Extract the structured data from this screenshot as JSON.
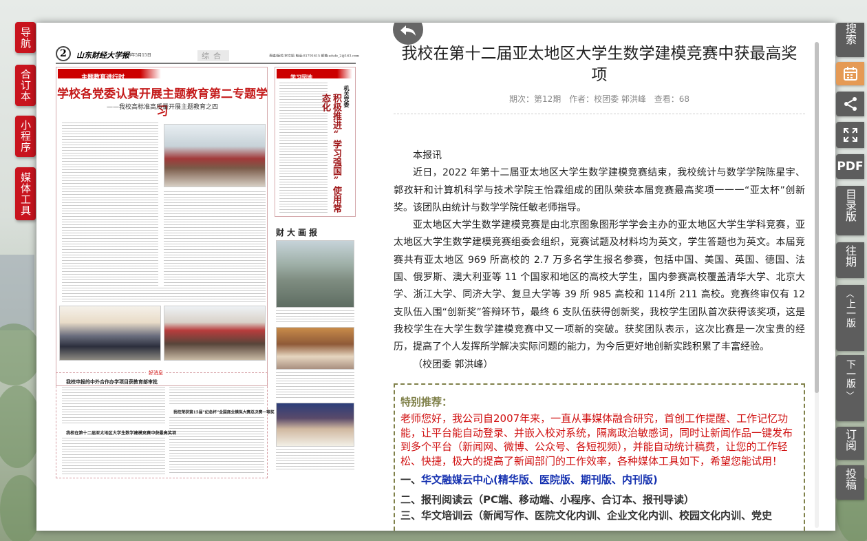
{
  "left_nav": [
    "导航",
    "合订本",
    "小程序",
    "媒体工具"
  ],
  "right_toolbar": {
    "search": "搜索",
    "calendar_icon": "calendar-icon",
    "share_icon": "share-icon",
    "fullscreen_icon": "fullscreen-icon",
    "pdf": "PDF",
    "catalog": "目录版",
    "past": "往期",
    "prev_page": "上一版",
    "next_page": "下一版",
    "subscribe": "订阅",
    "submit": "投稿"
  },
  "newspaper": {
    "page_number": "2",
    "paper_name": "山东财经大学报",
    "date": "2023年5月15日",
    "section": "综合",
    "header_info": "责编/版式:宋文娟  电话:81791615  邮箱:sdufe_2@163.com",
    "tag1": "主题教育进行时",
    "headline": "学校各党委认真开展主题教育第二专题学习",
    "subhead": "——我校高标准高质量开展主题教育之四",
    "tag2": "学习园地",
    "right_title": "机关党委",
    "right_vertical_headline": "积极推进“学习强国”使用常态化",
    "gallery_title": "财大画报",
    "tag3": "好消息",
    "brief1": "我校申报的中外合作办学项目获教育部审批",
    "brief2": "我校荣获第15届“纪念杯”全国商业模拟大赛总决赛一等奖",
    "brief3": "我校在第十二届亚太地区大学生数学建模竞赛中获最高奖项"
  },
  "article": {
    "title": "我校在第十二届亚太地区大学生数学建模竞赛中获最高奖项",
    "meta": {
      "issue": "期次：第12期",
      "author": "作者：校团委 郭洪峰",
      "views": "查看：68"
    },
    "paragraphs": [
      "本报讯",
      "近日，2022 年第十二届亚太地区大学生数学建模竞赛结束，我校统计与数学学院陈星宇、郭孜轩和计算机科学与技术学院王怡霖组成的团队荣获本届竞赛最高奖项一一一“亚太杯”创新奖。该团队由统计与数学学院任敏老师指导。",
      "亚太地区大学生数学建模竞赛是由北京图象图形学学会主办的亚太地区大学生学科竞赛，亚太地区大学生数学建模竞赛组委会组织，竞赛试题及材料均为英文，学生答题也为英文。本届竞赛共有亚太地区 969 所高校的 2.7 万多名学生报名参赛，包括中国、美国、英国、德国、法国、俄罗斯、澳大利亚等 11 个国家和地区的高校大学生，国内参赛高校覆盖清华大学、北京大学、浙江大学、同济大学、复旦大学等 39 所 985 高校和 114所 211 高校。竞赛终审仅有 12 支队伍入围“创新奖”答辩环节，最终 6 支队伍获得创新奖，我校学生团队首次获得该奖项，这是我校学生在大学生数学建模竞赛中又一项新的突破。获奖团队表示，这次比赛是一次宝贵的经历，提高了个人发挥所学解决实际问题的能力，为今后更好地创新实践积累了丰富经验。",
      "（校团委 郭洪峰）"
    ]
  },
  "recommend": {
    "title": "特别推荐：",
    "text": "老师您好，我公司自2007年来，一直从事媒体融合研究，首创工作提醒、工作记忆功能，让平台能自动登录、并嵌入校对系统，隔离政治敏感词，同时让新闻作品一键发布到多个平台（新闻网、微博、公众号、各短视频），并能自动统计稿费，让您的工作轻松、快捷，极大的提高了新闻部门的工作效率，各种媒体工具如下，希望您能试用！",
    "item1_prefix": "一、",
    "item1_link": "华文融媒云中心(精华版、医院版、期刊版、内刊版)",
    "item2": "二、报刊阅读云（PC端、移动端、小程序、合订本、报刊导读）",
    "item3": "三、华文培训云（新闻写作、医院文化内训、企业文化内训、校园文化内训、党史"
  },
  "colors": {
    "nav_red": "#c8141e",
    "toolbar_gray": "#5d5d5d",
    "calendar_orange": "#e59a55",
    "recommend_red": "#d01010",
    "recommend_link_blue": "#1531b0",
    "recommend_border": "#7f8049"
  }
}
